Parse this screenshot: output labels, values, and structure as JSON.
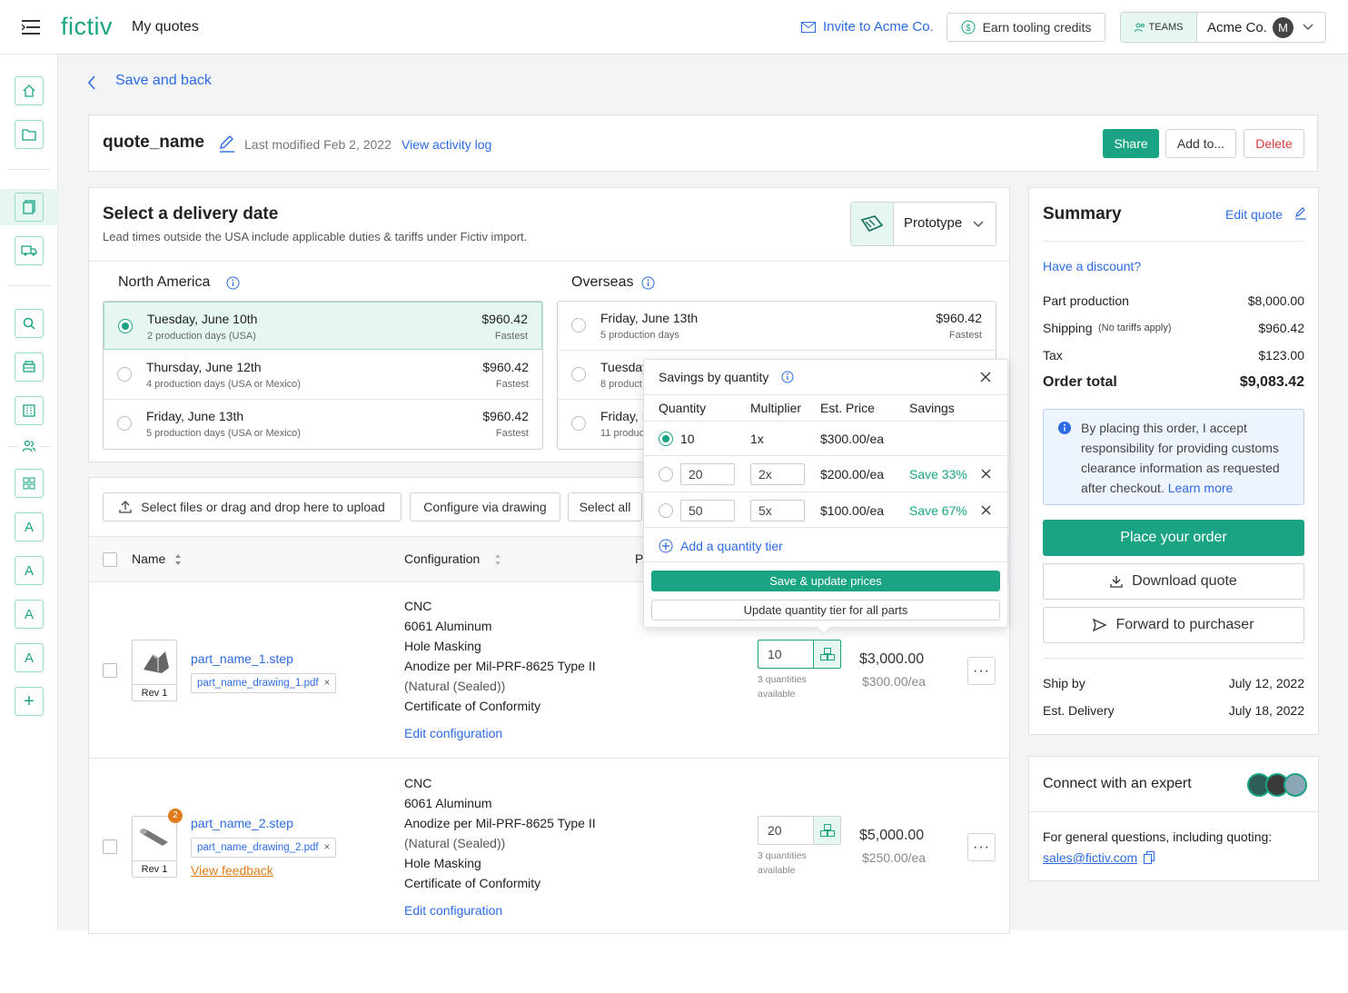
{
  "header": {
    "logo": "fictiv",
    "title": "My quotes",
    "invite": "Invite to Acme Co.",
    "earn": "Earn tooling credits",
    "teams": "TEAMS",
    "org": "Acme Co.",
    "avatar": "M"
  },
  "back": "Save and back",
  "quote": {
    "name": "quote_name",
    "modified": "Last modified Feb 2, 2022",
    "activity": "View activity log",
    "share": "Share",
    "add": "Add to...",
    "delete": "Delete"
  },
  "delivery": {
    "title": "Select a delivery date",
    "subtitle": "Lead times outside the USA include applicable duties & tariffs under Fictiv import.",
    "stage": "Prototype",
    "na_label": "North America",
    "os_label": "Overseas",
    "na": [
      {
        "date": "Tuesday, June 10th",
        "days": "2 production days (USA)",
        "price": "$960.42",
        "tag": "Fastest"
      },
      {
        "date": "Thursday, June 12th",
        "days": "4 production days (USA or Mexico)",
        "price": "$960.42",
        "tag": "Fastest"
      },
      {
        "date": "Friday, June 13th",
        "days": "5 production days (USA or Mexico)",
        "price": "$960.42",
        "tag": "Fastest"
      }
    ],
    "os": [
      {
        "date": "Friday, June 13th",
        "days": "5 production days",
        "price": "$960.42",
        "tag": "Fastest"
      },
      {
        "date": "Tuesday",
        "days": "8 product"
      },
      {
        "date": "Friday, I",
        "days": "11 produc"
      }
    ]
  },
  "parts": {
    "upload": "Select files or drag and drop here to upload",
    "configure": "Configure via drawing",
    "select_all": "Select all",
    "col_name": "Name",
    "col_config": "Configuration",
    "col_p": "P",
    "rows": [
      {
        "file": "part_name_1.step",
        "drawing": "part_name_drawing_1.pdf",
        "rev": "Rev 1",
        "config": [
          "CNC",
          "6061 Aluminum",
          "Hole Masking",
          "Anodize per Mil-PRF-8625 Type II",
          "(Natural (Sealed))",
          "Certificate of Conformity"
        ],
        "edit": "Edit configuration",
        "qty": "10",
        "qty_note1": "3 quantities",
        "qty_note2": "available",
        "price": "$3,000.00",
        "unit": "$300.00/ea"
      },
      {
        "file": "part_name_2.step",
        "drawing": "part_name_drawing_2.pdf",
        "rev": "Rev 1",
        "badge": "2",
        "feedback": "View feedback",
        "config": [
          "CNC",
          "6061 Aluminum",
          "Anodize per Mil-PRF-8625 Type II",
          "(Natural (Sealed))",
          "Hole Masking",
          "Certificate of Conformity"
        ],
        "edit": "Edit configuration",
        "qty": "20",
        "qty_note1": "3 quantities",
        "qty_note2": "available",
        "price": "$5,000.00",
        "unit": "$250.00/ea"
      }
    ]
  },
  "popup": {
    "title": "Savings by quantity",
    "h_qty": "Quantity",
    "h_mult": "Multiplier",
    "h_price": "Est. Price",
    "h_save": "Savings",
    "rows": [
      {
        "qty": "10",
        "mult": "1x",
        "price": "$300.00/ea",
        "save": ""
      },
      {
        "qty": "20",
        "mult": "2x",
        "price": "$200.00/ea",
        "save": "Save 33%"
      },
      {
        "qty": "50",
        "mult": "5x",
        "price": "$100.00/ea",
        "save": "Save 67%"
      }
    ],
    "add": "Add a quantity tier",
    "save_btn": "Save & update prices",
    "update_btn": "Update quantity tier for all parts"
  },
  "summary": {
    "title": "Summary",
    "edit": "Edit quote",
    "discount": "Have a discount?",
    "lines": [
      {
        "label": "Part production",
        "value": "$8,000.00"
      },
      {
        "label": "Shipping",
        "note": "(No tariffs apply)",
        "value": "$960.42"
      },
      {
        "label": "Tax",
        "value": "$123.00"
      }
    ],
    "total_label": "Order total",
    "total": "$9,083.42",
    "notice": "By placing this order, I accept responsibility for providing customs clearance information as requested after checkout.",
    "learn": "Learn more",
    "place": "Place your order",
    "download": "Download quote",
    "forward": "Forward to purchaser",
    "ship_label": "Ship by",
    "ship": "July 12, 2022",
    "deliv_label": "Est. Delivery",
    "deliv": "July 18, 2022"
  },
  "expert": {
    "title": "Connect with an expert",
    "text": "For general questions, including quoting:",
    "email": "sales@fictiv.com"
  },
  "colors": {
    "accent": "#1aa483",
    "link": "#2d6be4",
    "danger": "#d93b3b",
    "feedback": "#e07b1a"
  }
}
